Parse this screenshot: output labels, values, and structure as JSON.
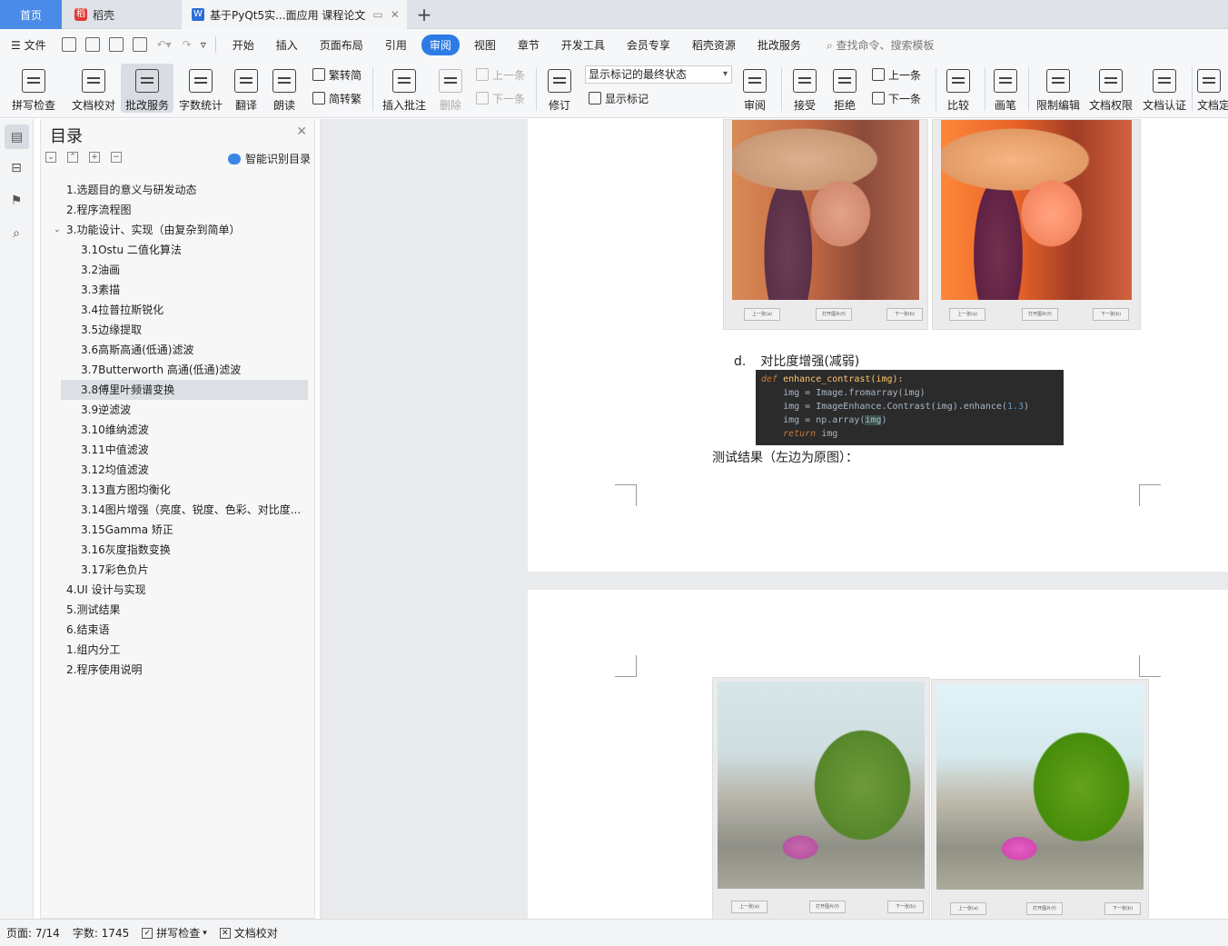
{
  "tabs": {
    "home": "首页",
    "daoke": "稻壳",
    "doc": "基于PyQt5实...面应用 课程论文",
    "add": "+"
  },
  "menubar": {
    "file": "文件",
    "items": [
      "开始",
      "插入",
      "页面布局",
      "引用",
      "审阅",
      "视图",
      "章节",
      "开发工具",
      "会员专享",
      "稻壳资源",
      "批改服务"
    ],
    "active": "审阅",
    "search": "查找命令、搜索模板"
  },
  "ribbon": {
    "spell": "拼写检查",
    "proof": "文档校对",
    "correct": "批改服务",
    "wordcount": "字数统计",
    "translate": "翻译",
    "read": "朗读",
    "trad": "繁转简",
    "simp": "简转繁",
    "insert_comment": "插入批注",
    "delete": "删除",
    "prev_comment": "上一条",
    "next_comment": "下一条",
    "revise": "修订",
    "markup_select": "显示标记的最终状态",
    "show_markup": "显示标记",
    "review": "审阅",
    "accept": "接受",
    "reject": "拒绝",
    "prev_change": "上一条",
    "next_change": "下一条",
    "compare": "比较",
    "pen": "画笔",
    "restrict": "限制编辑",
    "permission": "文档权限",
    "certify": "文档认证",
    "finalize": "文档定"
  },
  "toc": {
    "title": "目录",
    "smart": "智能识别目录",
    "items": [
      {
        "label": "1.选题目的意义与研发动态",
        "level": 1
      },
      {
        "label": "2.程序流程图",
        "level": 1
      },
      {
        "label": "3.功能设计、实现（由复杂到简单）",
        "level": 1
      },
      {
        "label": "3.1Ostu 二值化算法",
        "level": 2
      },
      {
        "label": "3.2油画",
        "level": 2
      },
      {
        "label": "3.3素描",
        "level": 2
      },
      {
        "label": "3.4拉普拉斯锐化",
        "level": 2
      },
      {
        "label": "3.5边缘提取",
        "level": 2
      },
      {
        "label": "3.6高斯高通(低通)滤波",
        "level": 2
      },
      {
        "label": "3.7Butterworth 高通(低通)滤波",
        "level": 2
      },
      {
        "label": "3.8傅里叶频谱变换",
        "level": 2,
        "selected": true
      },
      {
        "label": "3.9逆滤波",
        "level": 2
      },
      {
        "label": "3.10维纳滤波",
        "level": 2
      },
      {
        "label": "3.11中值滤波",
        "level": 2
      },
      {
        "label": "3.12均值滤波",
        "level": 2
      },
      {
        "label": "3.13直方图均衡化",
        "level": 2
      },
      {
        "label": "3.14图片增强（亮度、锐度、色彩、对比度...",
        "level": 2
      },
      {
        "label": "3.15Gamma 矫正",
        "level": 2
      },
      {
        "label": "3.16灰度指数变换",
        "level": 2
      },
      {
        "label": "3.17彩色负片",
        "level": 2
      },
      {
        "label": "4.UI 设计与实现",
        "level": 1
      },
      {
        "label": "5.测试结果",
        "level": 1
      },
      {
        "label": "6.结束语",
        "level": 1
      },
      {
        "label": "1.组内分工",
        "level": 1
      },
      {
        "label": "2.程序使用说明",
        "level": 1
      }
    ]
  },
  "document": {
    "fig_buttons": [
      "上一张(a)",
      "打开图片(f)",
      "下一张(b)"
    ],
    "heading_label": "d.",
    "heading_text": "对比度增强(减弱)",
    "code": {
      "l1_kw": "def",
      "l1_fn": " enhance_contrast(img):",
      "l2": "    img = Image.fromarray(img)",
      "l3_a": "    img = ImageEnhance.Contrast(img).enhance(",
      "l3_n": "1.3",
      "l3_b": ")",
      "l4_a": "    img = np.array(",
      "l4_h": "img",
      "l4_b": ")",
      "l5_kw": "    return",
      "l5_b": " img"
    },
    "result_text": "测试结果（左边为原图）："
  },
  "status": {
    "page": "页面: 7/14",
    "words": "字数: 1745",
    "spell": "拼写检查",
    "proof": "文档校对"
  }
}
